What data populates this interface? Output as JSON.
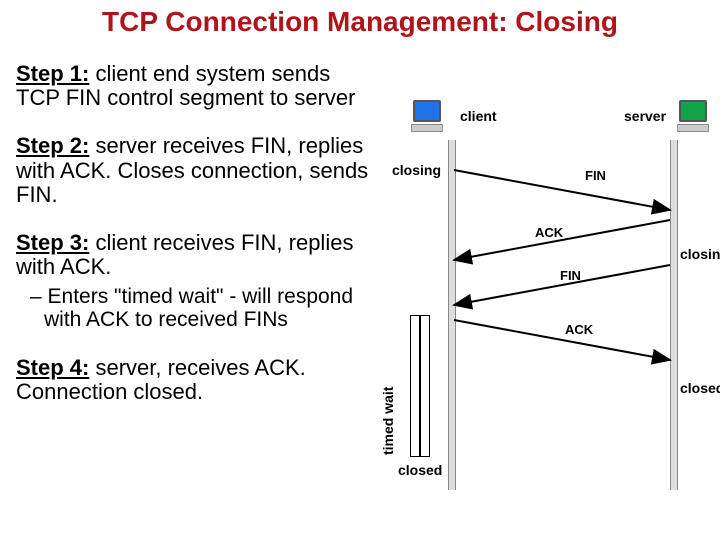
{
  "title": "TCP Connection Management: Closing",
  "steps": {
    "s1": {
      "head": "Step 1:",
      "body": " client end system sends TCP FIN control segment to server"
    },
    "s2": {
      "head": "Step 2:",
      "body": " server receives FIN, replies with ACK. Closes connection, sends FIN."
    },
    "s3": {
      "head": "Step 3:",
      "body": " client receives FIN, replies with ACK.",
      "sub": "Enters \"timed wait\" - will respond with ACK to received FINs"
    },
    "s4": {
      "head": "Step 4:",
      "body": " server, receives ACK. Connection closed."
    }
  },
  "diagram": {
    "client_label": "client",
    "server_label": "server",
    "closing_left": "closing",
    "closing_right": "closing",
    "closed_left": "closed",
    "closed_right": "closed",
    "timed_wait": "timed wait",
    "messages": {
      "fin1": "FIN",
      "ack1": "ACK",
      "fin2": "FIN",
      "ack2": "ACK"
    },
    "colors": {
      "title": "#b0131a",
      "client_screen": "#1e73e8",
      "server_screen": "#14a24a"
    }
  }
}
